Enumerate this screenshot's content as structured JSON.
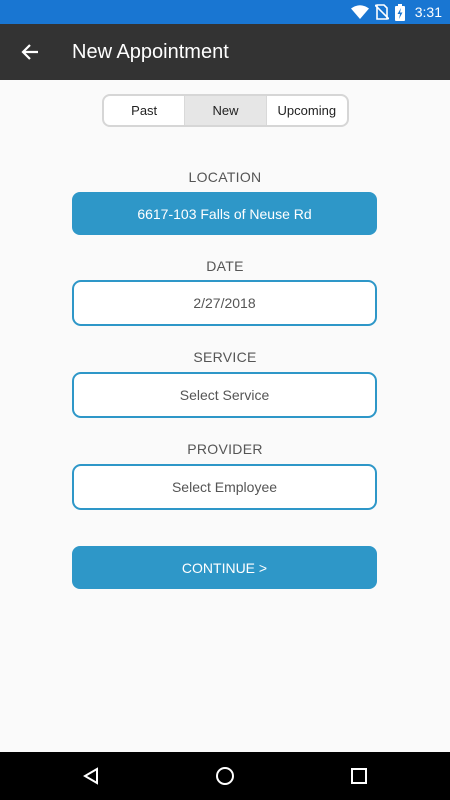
{
  "status_bar": {
    "time": "3:31",
    "icons": [
      "wifi-icon",
      "no-sim-icon",
      "battery-charging-icon"
    ],
    "color": "#1976d2"
  },
  "app_bar": {
    "title": "New Appointment",
    "back_icon": "arrow-back-icon",
    "color": "#333333"
  },
  "tabs": [
    {
      "label": "Past",
      "active": false
    },
    {
      "label": "New",
      "active": true
    },
    {
      "label": "Upcoming",
      "active": false
    }
  ],
  "form": {
    "location": {
      "label": "LOCATION",
      "value": "6617-103 Falls of Neuse Rd"
    },
    "date": {
      "label": "DATE",
      "value": "2/27/2018"
    },
    "service": {
      "label": "SERVICE",
      "placeholder": "Select Service"
    },
    "provider": {
      "label": "PROVIDER",
      "placeholder": "Select Employee"
    },
    "continue_label": "CONTINUE >"
  },
  "colors": {
    "accent": "#2e97c8",
    "background": "#fafafa"
  },
  "nav_bar": {
    "icons": [
      "nav-back-icon",
      "nav-home-icon",
      "nav-recents-icon"
    ]
  }
}
